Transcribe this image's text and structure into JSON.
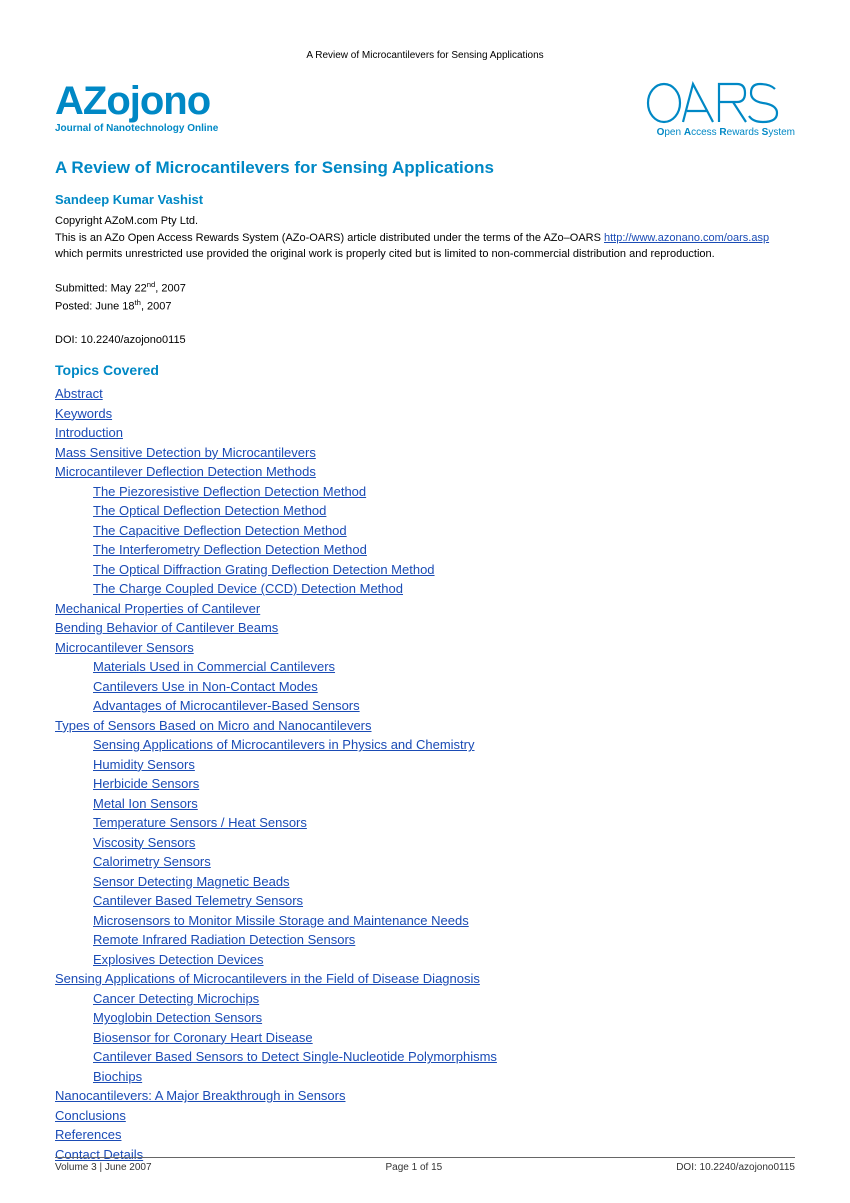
{
  "running_header": "A Review of Microcantilevers for Sensing Applications",
  "brand": {
    "title": "AZojono",
    "subtitle": "Journal of Nanotechnology Online"
  },
  "oars": {
    "title": "OARS",
    "sub_open": "O",
    "sub_open_rest": "pen ",
    "sub_access": "A",
    "sub_access_rest": "ccess ",
    "sub_rewards": "R",
    "sub_rewards_rest": "ewards ",
    "sub_system": "S",
    "sub_system_rest": "ystem"
  },
  "article_title": "A Review of Microcantilevers for Sensing Applications",
  "author": "Sandeep Kumar Vashist",
  "copyright": "Copyright AZoM.com Pty Ltd.",
  "oars_line1": "This is an AZo Open Access Rewards System (AZo-OARS) article distributed under the terms of the AZo–OARS ",
  "oars_link": "http://www.azonano.com/oars.asp",
  "oars_line2": " which permits unrestricted use provided the original work is properly cited but is limited to non-commercial distribution and reproduction.",
  "submitted_label": "Submitted: May 22",
  "submitted_sup": "nd",
  "submitted_year": ", 2007",
  "posted_label": "Posted: June 18",
  "posted_sup": "th",
  "posted_year": ", 2007",
  "doi": "DOI: 10.2240/azojono0115",
  "topics_heading": "Topics Covered",
  "toc": [
    {
      "lvl": 1,
      "text": "Abstract"
    },
    {
      "lvl": 1,
      "text": "Keywords"
    },
    {
      "lvl": 1,
      "text": "Introduction"
    },
    {
      "lvl": 1,
      "text": "Mass Sensitive Detection by Microcantilevers"
    },
    {
      "lvl": 1,
      "text": "Microcantilever Deflection Detection Methods"
    },
    {
      "lvl": 2,
      "text": "The Piezoresistive Deflection Detection Method"
    },
    {
      "lvl": 2,
      "text": "The Optical Deflection Detection Method"
    },
    {
      "lvl": 2,
      "text": "The Capacitive Deflection Detection Method"
    },
    {
      "lvl": 2,
      "text": "The Interferometry Deflection Detection Method"
    },
    {
      "lvl": 2,
      "text": "The Optical Diffraction Grating Deflection Detection Method"
    },
    {
      "lvl": 2,
      "text": "The Charge Coupled Device (CCD) Detection Method"
    },
    {
      "lvl": 1,
      "text": "Mechanical Properties of Cantilever"
    },
    {
      "lvl": 1,
      "text": "Bending Behavior of Cantilever Beams"
    },
    {
      "lvl": 1,
      "text": "Microcantilever Sensors"
    },
    {
      "lvl": 2,
      "text": "Materials Used in Commercial Cantilevers"
    },
    {
      "lvl": 2,
      "text": "Cantilevers Use in Non-Contact Modes"
    },
    {
      "lvl": 2,
      "text": "Advantages of Microcantilever-Based Sensors"
    },
    {
      "lvl": 1,
      "text": "Types of Sensors Based on Micro  and Nanocantilevers"
    },
    {
      "lvl": 2,
      "text": "Sensing Applications of Microcantilevers in Physics and Chemistry"
    },
    {
      "lvl": 2,
      "text": "Humidity Sensors"
    },
    {
      "lvl": 2,
      "text": "Herbicide Sensors"
    },
    {
      "lvl": 2,
      "text": "Metal Ion Sensors"
    },
    {
      "lvl": 2,
      "text": "Temperature Sensors / Heat Sensors"
    },
    {
      "lvl": 2,
      "text": "Viscosity Sensors"
    },
    {
      "lvl": 2,
      "text": "Calorimetry Sensors"
    },
    {
      "lvl": 2,
      "text": "Sensor Detecting Magnetic Beads"
    },
    {
      "lvl": 2,
      "text": "Cantilever Based Telemetry Sensors"
    },
    {
      "lvl": 2,
      "text": "Microsensors to Monitor Missile Storage and Maintenance Needs"
    },
    {
      "lvl": 2,
      "text": "Remote Infrared Radiation Detection Sensors"
    },
    {
      "lvl": 2,
      "text": "Explosives Detection Devices"
    },
    {
      "lvl": 1,
      "text": "Sensing Applications of Microcantilevers in the Field of Disease Diagnosis"
    },
    {
      "lvl": 2,
      "text": "Cancer Detecting Microchips"
    },
    {
      "lvl": 2,
      "text": "Myoglobin Detection Sensors"
    },
    {
      "lvl": 2,
      "text": "Biosensor for Coronary Heart Disease"
    },
    {
      "lvl": 2,
      "text": "Cantilever Based Sensors to Detect Single-Nucleotide Polymorphisms"
    },
    {
      "lvl": 2,
      "text": "Biochips"
    },
    {
      "lvl": 1,
      "text": "Nanocantilevers: A Major Breakthrough in Sensors"
    },
    {
      "lvl": 1,
      "text": "Conclusions"
    },
    {
      "lvl": 1,
      "text": "References"
    },
    {
      "lvl": 1,
      "text": "Contact Details"
    }
  ],
  "footer": {
    "left": "Volume 3 | June 2007",
    "center": "Page 1 of 15",
    "right": "DOI: 10.2240/azojono0115"
  }
}
